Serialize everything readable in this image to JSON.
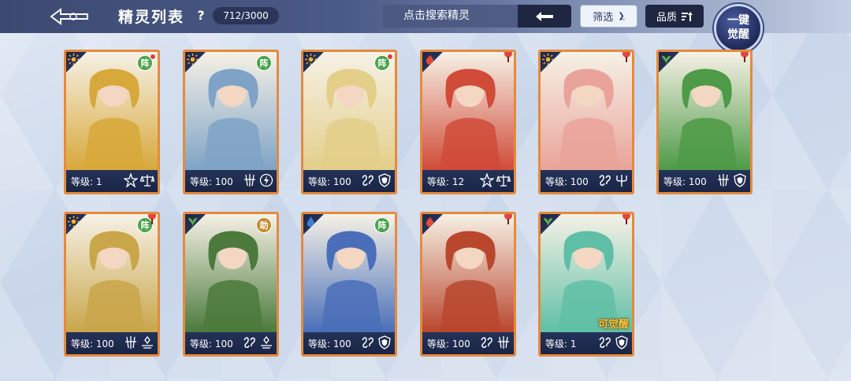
{
  "header": {
    "title": "精灵列表",
    "help": "?",
    "count": "712/3000",
    "search_placeholder": "点击搜索精灵",
    "filter_label": "筛选",
    "quality_label": "品质",
    "awaken_line1": "一键",
    "awaken_line2": "觉醒"
  },
  "cards": [
    {
      "level_label": "等级: 1",
      "element": "light",
      "badge": "阵",
      "red_dot": true,
      "pin": false,
      "stats": [
        "star-icon",
        "scale-icon"
      ],
      "art_color": "#d7a83a"
    },
    {
      "level_label": "等级: 100",
      "element": "light",
      "badge": "阵",
      "red_dot": false,
      "pin": false,
      "stats": [
        "claw-icon",
        "lightning-icon"
      ],
      "art_color": "#7fa3c6"
    },
    {
      "level_label": "等级: 100",
      "element": "light",
      "badge": "阵",
      "red_dot": true,
      "pin": false,
      "stats": [
        "wave-icon",
        "shield-icon"
      ],
      "art_color": "#e3cf8a"
    },
    {
      "level_label": "等级: 12",
      "element": "fire",
      "badge": "",
      "red_dot": false,
      "pin": true,
      "stats": [
        "star-icon",
        "scale-icon"
      ],
      "art_color": "#d04b38"
    },
    {
      "level_label": "等级: 100",
      "element": "light",
      "badge": "",
      "red_dot": false,
      "pin": true,
      "stats": [
        "wave-icon",
        "trident-icon"
      ],
      "art_color": "#e9a39a"
    },
    {
      "level_label": "等级: 100",
      "element": "grass",
      "badge": "",
      "red_dot": false,
      "pin": true,
      "stats": [
        "claw-icon",
        "shield-icon"
      ],
      "art_color": "#4e9a47"
    },
    {
      "level_label": "等级: 100",
      "element": "light",
      "badge": "阵",
      "red_dot": true,
      "pin": true,
      "stats": [
        "claw-icon",
        "balance-icon"
      ],
      "art_color": "#c9a64a"
    },
    {
      "level_label": "等级: 100",
      "element": "grass",
      "badge": "助",
      "red_dot": false,
      "pin": false,
      "stats": [
        "wave-icon",
        "balance-icon"
      ],
      "art_color": "#4b7a3c"
    },
    {
      "level_label": "等级: 100",
      "element": "water",
      "badge": "阵",
      "red_dot": false,
      "pin": false,
      "stats": [
        "wave-icon",
        "shield-icon"
      ],
      "art_color": "#4a6fb8"
    },
    {
      "level_label": "等级: 100",
      "element": "fire",
      "badge": "",
      "red_dot": false,
      "pin": true,
      "stats": [
        "wave-icon",
        "claw-icon"
      ],
      "art_color": "#b9472e"
    },
    {
      "level_label": "等级: 1",
      "element": "grass",
      "badge": "",
      "red_dot": false,
      "pin": true,
      "stats": [
        "wave-icon",
        "shield-icon"
      ],
      "art_color": "#5fbfa6",
      "awake_tag": "可觉醒"
    }
  ],
  "colors": {
    "card_border": "#e58a3c",
    "footer_bg": "#1a2546",
    "light": "#f2b234",
    "fire": "#e2493b",
    "grass": "#5fb34a",
    "water": "#3d7fd8"
  }
}
